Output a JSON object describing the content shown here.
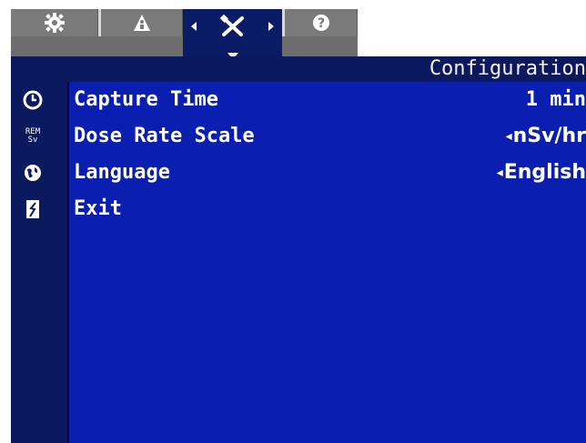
{
  "colors": {
    "tab_gray": "#7a7a7a",
    "tab_active": "#0b1c66",
    "sidebar_navy": "#0b1a5e",
    "panel_blue": "#0a1fb0",
    "text": "#ffffff"
  },
  "tabs": [
    {
      "icon": "gear-icon",
      "active": false
    },
    {
      "icon": "alert-person-icon",
      "active": false
    },
    {
      "icon": "tools-icon",
      "active": true
    },
    {
      "icon": "help-icon",
      "active": false
    }
  ],
  "title": "Configuration",
  "sidebar_icons": [
    "clock-icon",
    "rem-sv-icon",
    "globe-icon",
    "exit-door-icon"
  ],
  "sidebar_rem_label": "REM",
  "sidebar_sv_label": "Sv",
  "rows": [
    {
      "label": "Capture Time",
      "value": "1 min",
      "value_arrow": ""
    },
    {
      "label": "Dose Rate Scale",
      "value": "nSv/hr",
      "value_arrow": "◂"
    },
    {
      "label": "Language",
      "value": "English",
      "value_arrow": "◂"
    },
    {
      "label": "Exit",
      "value": "",
      "value_arrow": ""
    }
  ]
}
